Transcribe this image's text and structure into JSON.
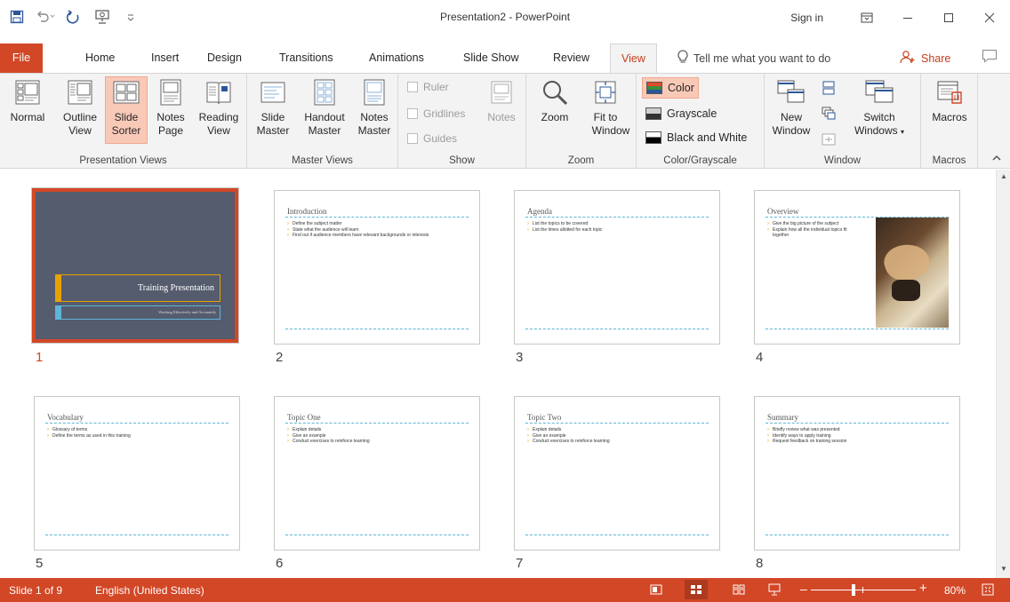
{
  "window": {
    "title": "Presentation2 - PowerPoint",
    "sign_in": "Sign in"
  },
  "tabs": {
    "file": "File",
    "home": "Home",
    "insert": "Insert",
    "design": "Design",
    "transitions": "Transitions",
    "animations": "Animations",
    "slide_show": "Slide Show",
    "review": "Review",
    "view": "View",
    "tell_me": "Tell me what you want to do",
    "share": "Share"
  },
  "ribbon": {
    "presentation_views": {
      "label": "Presentation Views",
      "normal": "Normal",
      "outline_1": "Outline",
      "outline_2": "View",
      "sorter_1": "Slide",
      "sorter_2": "Sorter",
      "notes_1": "Notes",
      "notes_2": "Page",
      "reading_1": "Reading",
      "reading_2": "View"
    },
    "master_views": {
      "label": "Master Views",
      "slide_1": "Slide",
      "slide_2": "Master",
      "handout_1": "Handout",
      "handout_2": "Master",
      "notes_1": "Notes",
      "notes_2": "Master"
    },
    "show": {
      "label": "Show",
      "ruler": "Ruler",
      "gridlines": "Gridlines",
      "guides": "Guides",
      "notes": "Notes"
    },
    "zoom": {
      "label": "Zoom",
      "zoom": "Zoom",
      "fit_1": "Fit to",
      "fit_2": "Window"
    },
    "color": {
      "label": "Color/Grayscale",
      "color": "Color",
      "grayscale": "Grayscale",
      "bw": "Black and White"
    },
    "window": {
      "label": "Window",
      "new_1": "New",
      "new_2": "Window",
      "switch_1": "Switch",
      "switch_2": "Windows"
    },
    "macros": {
      "label": "Macros",
      "macros": "Macros"
    }
  },
  "slides": [
    {
      "num": "1",
      "title": "Training Presentation",
      "subtitle": "Working Effectively and Accurately"
    },
    {
      "num": "2",
      "title": "Introduction",
      "bullets": [
        "Define the subject matter",
        "State what the audience will learn",
        "Find out if audience members have relevant backgrounds or interests"
      ]
    },
    {
      "num": "3",
      "title": "Agenda",
      "bullets": [
        "List the topics to be covered",
        "List the times allotted for each topic"
      ]
    },
    {
      "num": "4",
      "title": "Overview",
      "bullets": [
        "Give the big picture of the subject",
        "Explain how all the individual topics fit together"
      ]
    },
    {
      "num": "5",
      "title": "Vocabulary",
      "bullets": [
        "Glossary of terms",
        "Define the terms as used in this training"
      ]
    },
    {
      "num": "6",
      "title": "Topic One",
      "bullets": [
        "Explain details",
        "Give an example",
        "Conduct exercises to reinforce learning"
      ]
    },
    {
      "num": "7",
      "title": "Topic Two",
      "bullets": [
        "Explain details",
        "Give an example",
        "Conduct exercises to reinforce learning"
      ]
    },
    {
      "num": "8",
      "title": "Summary",
      "bullets": [
        "Briefly review what was presented",
        "Identify ways to apply training",
        "Request feedback on training session"
      ]
    }
  ],
  "status": {
    "slide": "Slide 1 of 9",
    "language": "English (United States)",
    "zoom": "80%",
    "zoom_level": 0.8
  },
  "colors": {
    "accent": "#d24726",
    "ribbon_bg": "#f3f3f3",
    "title_slide_bg": "#555c6e",
    "gold": "#e8a200",
    "blue": "#5fb4d9"
  },
  "icons": [
    "save-icon",
    "undo-icon",
    "redo-icon",
    "present-icon",
    "customize-icon",
    "ribbon-display-icon",
    "minimize-icon",
    "maximize-icon",
    "close-icon",
    "lightbulb-icon",
    "person-plus-icon",
    "comment-icon",
    "magnifier-icon",
    "fit-window-icon"
  ]
}
